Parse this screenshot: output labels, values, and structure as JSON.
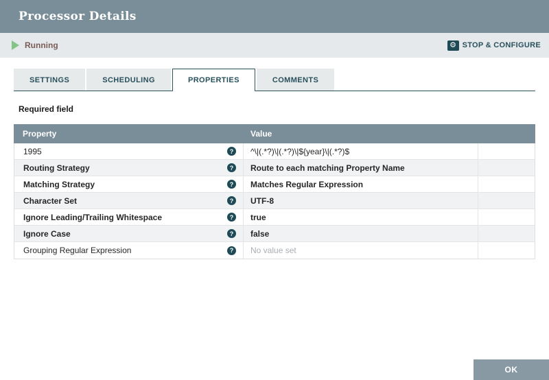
{
  "header": {
    "title": "Processor Details"
  },
  "status_bar": {
    "state_label": "Running",
    "state_icon": "play-triangle",
    "state_icon_color": "#84C587",
    "action_label": "STOP & CONFIGURE",
    "action_icon": "gear",
    "gear_glyph": "⚙"
  },
  "tabs": [
    {
      "label": "SETTINGS",
      "active": false
    },
    {
      "label": "SCHEDULING",
      "active": false
    },
    {
      "label": "PROPERTIES",
      "active": true
    },
    {
      "label": "COMMENTS",
      "active": false
    }
  ],
  "required_field_label": "Required field",
  "table": {
    "columns": {
      "property": "Property",
      "value": "Value"
    },
    "help_glyph": "?",
    "rows": [
      {
        "property": "1995",
        "value": "^\\|(.*?)\\|(.*?)\\|${year}\\|(.*?)$",
        "required": false,
        "value_placeholder": false
      },
      {
        "property": "Routing Strategy",
        "value": "Route to each matching Property Name",
        "required": true,
        "value_placeholder": false
      },
      {
        "property": "Matching Strategy",
        "value": "Matches Regular Expression",
        "required": true,
        "value_placeholder": false
      },
      {
        "property": "Character Set",
        "value": "UTF-8",
        "required": true,
        "value_placeholder": false
      },
      {
        "property": "Ignore Leading/Trailing Whitespace",
        "value": "true",
        "required": true,
        "value_placeholder": false
      },
      {
        "property": "Ignore Case",
        "value": "false",
        "required": true,
        "value_placeholder": false
      },
      {
        "property": "Grouping Regular Expression",
        "value": "No value set",
        "required": false,
        "value_placeholder": true
      }
    ]
  },
  "footer": {
    "ok_label": "OK"
  },
  "colors": {
    "header_bg": "#7A8E99",
    "status_bg": "#E6E9EB",
    "accent_teal": "#1E4A55",
    "tab_text": "#28505C",
    "running_text": "#7A5C58",
    "row_alt_bg": "#F0F2F3",
    "placeholder_text": "#A9AFB6",
    "ok_bg": "#8899A4"
  }
}
